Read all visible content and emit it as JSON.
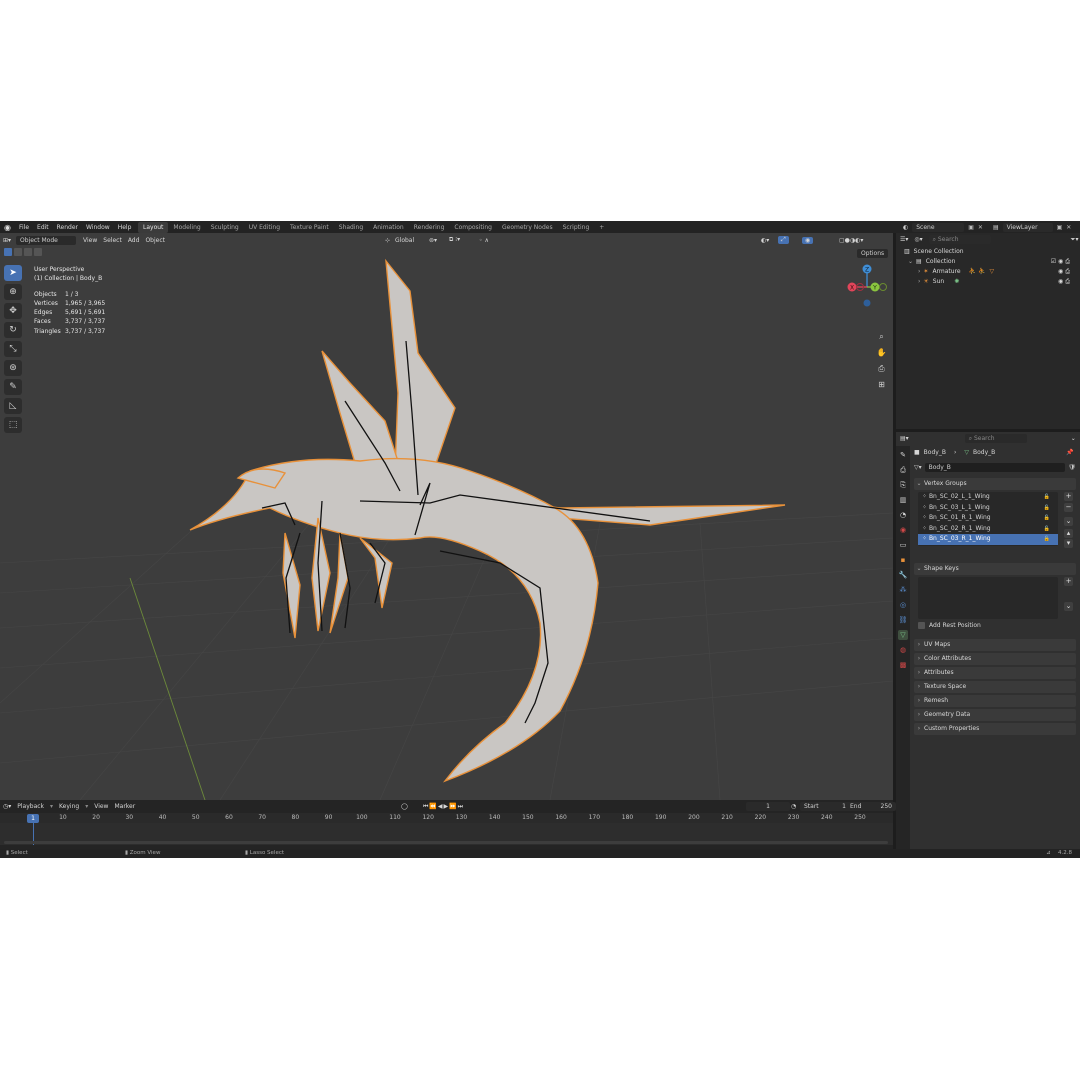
{
  "menu": [
    "File",
    "Edit",
    "Render",
    "Window",
    "Help"
  ],
  "workspaces": [
    "Layout",
    "Modeling",
    "Sculpting",
    "UV Editing",
    "Texture Paint",
    "Shading",
    "Animation",
    "Rendering",
    "Compositing",
    "Geometry Nodes",
    "Scripting"
  ],
  "add_workspace": "+",
  "scene": {
    "scene_name": "Scene",
    "view_layer": "ViewLayer"
  },
  "viewport": {
    "mode": "Object Mode",
    "menus": [
      "View",
      "Select",
      "Add",
      "Object"
    ],
    "transform_orientation": "Global",
    "options_label": "Options",
    "info_title": "User Perspective",
    "info_sub": "(1) Collection | Body_B",
    "stats": [
      {
        "k": "Objects",
        "v": "1 / 3"
      },
      {
        "k": "Vertices",
        "v": "1,965 / 3,965"
      },
      {
        "k": "Edges",
        "v": "5,691 / 5,691"
      },
      {
        "k": "Faces",
        "v": "3,737 / 3,737"
      },
      {
        "k": "Triangles",
        "v": "3,737 / 3,737"
      }
    ],
    "gizmo": {
      "x": "X",
      "y": "Y",
      "z": "Z"
    }
  },
  "timeline": {
    "menus": [
      "Playback",
      "Keying",
      "View",
      "Marker"
    ],
    "current_frame": "1",
    "start_label": "Start",
    "start": "1",
    "end_label": "End",
    "end": "250",
    "ticks": [
      "1",
      "10",
      "20",
      "30",
      "40",
      "50",
      "60",
      "70",
      "80",
      "90",
      "100",
      "110",
      "120",
      "130",
      "140",
      "150",
      "160",
      "170",
      "180",
      "190",
      "200",
      "210",
      "220",
      "230",
      "240",
      "250"
    ]
  },
  "status": {
    "select": "Select",
    "zoom": "Zoom View",
    "lasso": "Lasso Select",
    "version": "4.2.8"
  },
  "outliner": {
    "search_placeholder": "Search",
    "scene_collection": "Scene Collection",
    "collection": "Collection",
    "items": [
      "Armature",
      "Sun"
    ]
  },
  "properties": {
    "search_placeholder": "Search",
    "breadcrumb_object": "Body_B",
    "breadcrumb_mesh": "Body_B",
    "mesh_name": "Body_B",
    "vertex_groups_title": "Vertex Groups",
    "vertex_groups": [
      "Bn_SC_02_L_1_Wing",
      "Bn_SC_03_L_1_Wing",
      "Bn_SC_01_R_1_Wing",
      "Bn_SC_02_R_1_Wing",
      "Bn_SC_03_R_1_Wing"
    ],
    "selected_index": 4,
    "shape_keys_title": "Shape Keys",
    "add_rest_position": "Add Rest Position",
    "panels": [
      "UV Maps",
      "Color Attributes",
      "Attributes",
      "Texture Space",
      "Remesh",
      "Geometry Data",
      "Custom Properties"
    ]
  },
  "colors": {
    "accent": "#4772b3",
    "outline": "#e8913a",
    "axis_x": "#e2455a",
    "axis_y": "#8bc43f",
    "axis_z": "#3f8ed6"
  }
}
